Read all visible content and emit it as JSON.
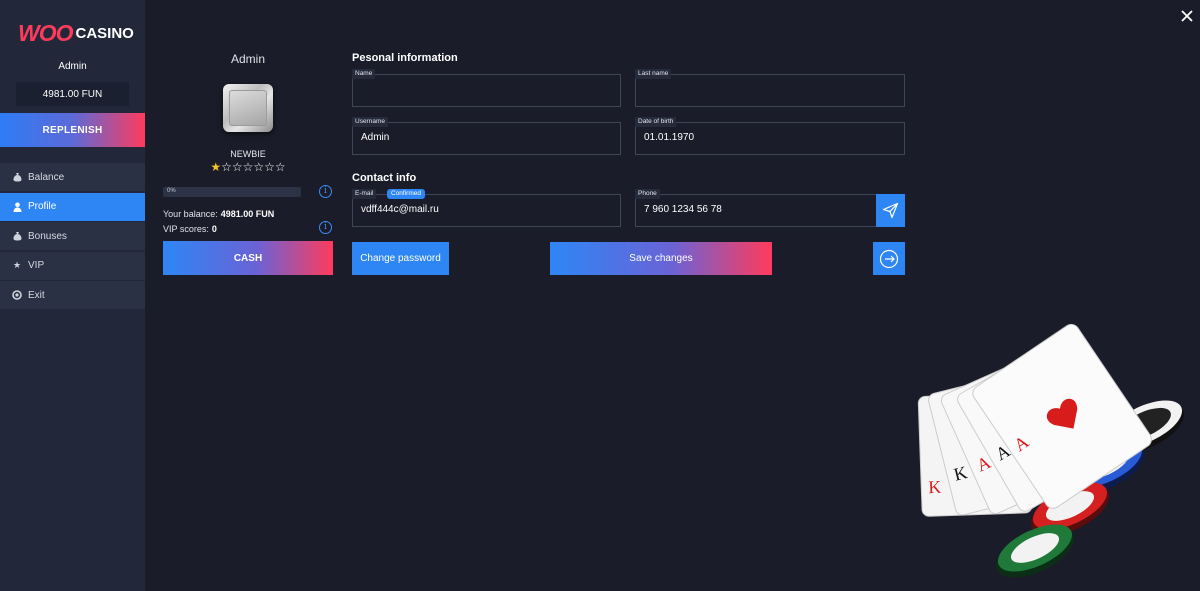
{
  "brand": {
    "logo_woo": "WOO",
    "logo_casino": "CASINO",
    "accent": "#ff3b5c",
    "primary": "#2e86f5"
  },
  "sidebar": {
    "username": "Admin",
    "balance": "4981.00 FUN",
    "replenish_label": "REPLENISH",
    "items": [
      {
        "label": "Balance",
        "icon": "money-bag-icon",
        "active": false
      },
      {
        "label": "Profile",
        "icon": "user-icon",
        "active": true
      },
      {
        "label": "Bonuses",
        "icon": "gift-icon",
        "active": false
      },
      {
        "label": "VIP",
        "icon": "star-icon",
        "active": false
      },
      {
        "label": "Exit",
        "icon": "power-icon",
        "active": false
      }
    ]
  },
  "profile": {
    "title": "Admin",
    "rank": "NEWBIE",
    "stars_filled": 1,
    "stars_total": 7,
    "progress_label": "0%",
    "progress_value": 0,
    "balance_label": "Your balance:",
    "balance_value": "4981.00 FUN",
    "vip_label": "VIP scores:",
    "vip_value": "0",
    "cash_label": "CASH"
  },
  "form": {
    "personal_title": "Pesonal information",
    "contact_title": "Contact info",
    "name": {
      "label": "Name",
      "value": ""
    },
    "last_name": {
      "label": "Last name",
      "value": ""
    },
    "username": {
      "label": "Username",
      "value": "Admin"
    },
    "dob": {
      "label": "Date of birth",
      "value": "01.01.1970"
    },
    "email": {
      "label": "E-mail",
      "value": "vdff444c@mail.ru",
      "status": "Confirmed"
    },
    "phone": {
      "label": "Phone",
      "value": "7 960 1234 56 78"
    },
    "change_password_label": "Change password",
    "save_label": "Save changes"
  }
}
